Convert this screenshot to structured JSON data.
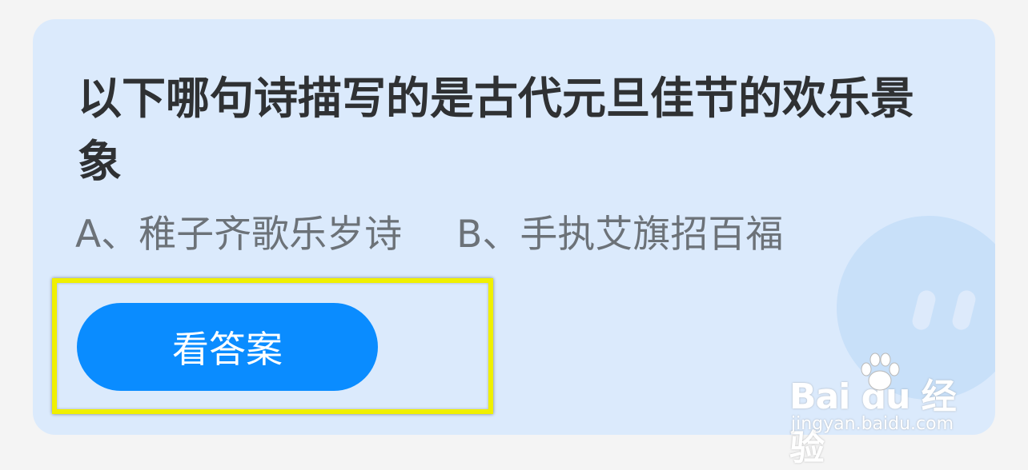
{
  "question": {
    "text": "以下哪句诗描写的是古代元旦佳节的欢乐景象"
  },
  "options": [
    {
      "label": "A、稚子齐歌乐岁诗"
    },
    {
      "label": "B、手执艾旗招百福"
    }
  ],
  "answer_button": {
    "label": "看答案"
  },
  "watermark": {
    "logo": "Bai du 经验",
    "url": "jingyan.baidu.com"
  },
  "colors": {
    "card_background": "#dbeafc",
    "button": "#0a8cff",
    "highlight": "#f0f000",
    "question_text": "#2f3133",
    "option_text": "#6c7278"
  },
  "icons": {
    "mascot": "mascot-face-icon",
    "paw": "baidu-paw-icon"
  }
}
